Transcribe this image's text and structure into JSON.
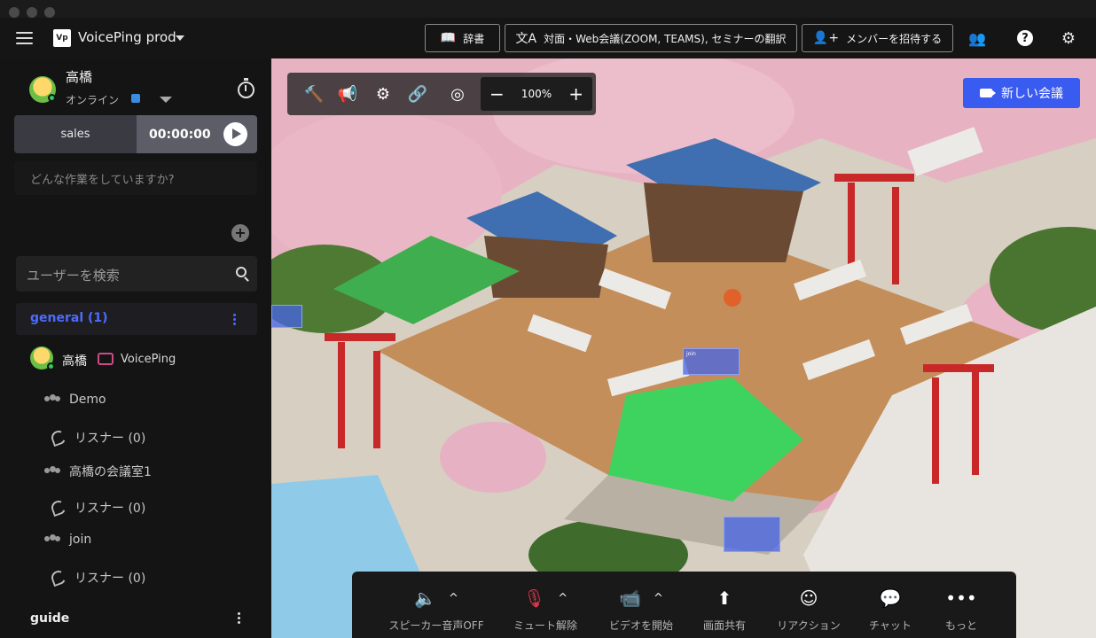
{
  "topbar": {
    "workspace_logo": "Vp",
    "workspace_name": "VoicePing prod",
    "dictionary_label": "辞書",
    "translation_label": "対面・Web会議(ZOOM, TEAMS), セミナーの翻訳",
    "invite_label": "メンバーを招待する"
  },
  "profile": {
    "name": "高橋",
    "status": "オンライン"
  },
  "timer": {
    "tag": "sales",
    "value": "00:00:00"
  },
  "task_placeholder": "どんな作業をしていますか?",
  "search_placeholder": "ユーザーを検索",
  "channels": [
    {
      "label": "general (1)",
      "member": {
        "name": "高橋",
        "app": "VoicePing"
      },
      "rooms": [
        {
          "name": "Demo",
          "listeners": "リスナー (0)"
        },
        {
          "name": "高橋の会議室1",
          "listeners": "リスナー (0)"
        },
        {
          "name": "join",
          "listeners": "リスナー (0)"
        }
      ]
    },
    {
      "label": "guide"
    }
  ],
  "map": {
    "zoom": "100%",
    "new_meeting_label": "新しい会議",
    "zones": [
      "join"
    ]
  },
  "bottombar": {
    "speaker": "スピーカー音声OFF",
    "mute": "ミュート解除",
    "video": "ビデオを開始",
    "share": "画面共有",
    "reaction": "リアクション",
    "chat": "チャット",
    "more": "もっと"
  },
  "colors": {
    "accent": "#3a5bf0",
    "channel_active": "#4d6bff",
    "off_state": "#e0354a"
  }
}
